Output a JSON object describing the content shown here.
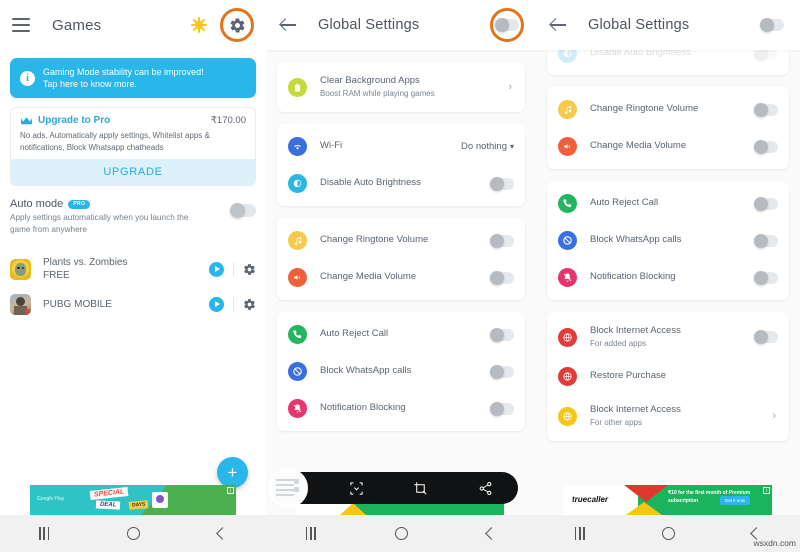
{
  "panel1": {
    "header": {
      "title": "Games",
      "menu_icon": "hamburger-icon",
      "sun_icon": "sun-icon",
      "gear_icon": "gear-icon"
    },
    "banner": {
      "icon": "info-icon",
      "line1": "Gaming Mode stability can be improved!",
      "line2": "Tap here to know more."
    },
    "upgrade": {
      "icon": "crown-icon",
      "title": "Upgrade to Pro",
      "price": "₹170.00",
      "description": "No ads, Automatically apply settings, Whitelist apps & notifications, Block Whatsapp chatheads",
      "button": "UPGRADE"
    },
    "auto_mode": {
      "title": "Auto mode",
      "badge": "PRO",
      "subtitle": "Apply settings automatically when you launch the game from anywhere",
      "toggle_on": false
    },
    "games": [
      {
        "name": "Plants vs. Zombies",
        "sub": "FREE",
        "play_icon": "play-icon",
        "gear_icon": "gear-icon"
      },
      {
        "name": "PUBG MOBILE",
        "sub": "",
        "play_icon": "play-icon",
        "gear_icon": "gear-icon"
      }
    ],
    "fab": {
      "label": "+",
      "icon": "plus-icon"
    },
    "ad": {
      "brand": "Google Play",
      "text1": "SPECIAL",
      "text2": "DEAL",
      "text3": "DAYS",
      "badge": "i"
    }
  },
  "panel2": {
    "header": {
      "back_icon": "back-arrow-icon",
      "title": "Global Settings",
      "toggle_on": false,
      "highlighted": true
    },
    "cards": [
      {
        "rows": [
          {
            "icon": "trash-icon",
            "icon_color": "#c5d93b",
            "label": "Clear Background Apps",
            "sub": "Boost RAM while playing games",
            "control": "chevron",
            "chevron": "›"
          }
        ]
      },
      {
        "rows": [
          {
            "icon": "wifi-icon",
            "icon_color": "#3b6ede",
            "label": "Wi-Fi",
            "sub": "",
            "control": "dropdown",
            "value": "Do nothing"
          },
          {
            "icon": "brightness-icon",
            "icon_color": "#29b6e8",
            "label": "Disable Auto Brightness",
            "sub": "",
            "control": "toggle",
            "toggle_on": false
          }
        ]
      },
      {
        "rows": [
          {
            "icon": "music-note-icon",
            "icon_color": "#f7c948",
            "label": "Change Ringtone Volume",
            "sub": "",
            "control": "toggle",
            "toggle_on": false
          },
          {
            "icon": "speaker-icon",
            "icon_color": "#f0603c",
            "label": "Change Media Volume",
            "sub": "",
            "control": "toggle",
            "toggle_on": false
          }
        ]
      },
      {
        "rows": [
          {
            "icon": "phone-reject-icon",
            "icon_color": "#22b562",
            "label": "Auto Reject Call",
            "sub": "",
            "control": "toggle",
            "toggle_on": false
          },
          {
            "icon": "block-call-icon",
            "icon_color": "#3b6ede",
            "label": "Block WhatsApp calls",
            "sub": "",
            "control": "toggle",
            "toggle_on": false
          },
          {
            "icon": "bell-off-icon",
            "icon_color": "#e8356d",
            "label": "Notification Blocking",
            "sub": "",
            "control": "toggle",
            "toggle_on": false
          }
        ]
      }
    ],
    "screenshot_toolbar": {
      "thumbnail": "screenshot-thumbnail",
      "buttons": [
        "scroll-capture-icon",
        "crop-edit-icon",
        "share-icon"
      ]
    }
  },
  "panel3": {
    "header": {
      "back_icon": "back-arrow-icon",
      "title": "Global Settings",
      "toggle_on": false
    },
    "scrolled_row": {
      "icon": "brightness-icon",
      "icon_color": "#29b6e8",
      "label": "Disable Auto Brightness",
      "control": "toggle",
      "toggle_on": false
    },
    "cards": [
      {
        "rows": [
          {
            "icon": "music-note-icon",
            "icon_color": "#f7c948",
            "label": "Change Ringtone Volume",
            "sub": "",
            "control": "toggle",
            "toggle_on": false
          },
          {
            "icon": "speaker-icon",
            "icon_color": "#f0603c",
            "label": "Change Media Volume",
            "sub": "",
            "control": "toggle",
            "toggle_on": false
          }
        ]
      },
      {
        "rows": [
          {
            "icon": "phone-reject-icon",
            "icon_color": "#22b562",
            "label": "Auto Reject Call",
            "sub": "",
            "control": "toggle",
            "toggle_on": false
          },
          {
            "icon": "block-call-icon",
            "icon_color": "#3b6ede",
            "label": "Block WhatsApp calls",
            "sub": "",
            "control": "toggle",
            "toggle_on": false
          },
          {
            "icon": "bell-off-icon",
            "icon_color": "#e8356d",
            "label": "Notification Blocking",
            "sub": "",
            "control": "toggle",
            "toggle_on": false
          }
        ]
      },
      {
        "rows": [
          {
            "icon": "globe-block-icon",
            "icon_color": "#e03c3c",
            "label": "Block Internet Access",
            "sub": "For added apps",
            "control": "toggle",
            "toggle_on": false
          },
          {
            "icon": "globe-block-icon",
            "icon_color": "#e03c3c",
            "label": "Restore Purchase",
            "sub": "",
            "control": "none"
          },
          {
            "icon": "globe-block-icon",
            "icon_color": "#f5c518",
            "label": "Block Internet Access",
            "sub": "For other apps",
            "control": "chevron",
            "chevron": "›"
          }
        ]
      }
    ],
    "ad": {
      "brand": "truecaller",
      "copy": "₹10 for the first month of Premium subscription",
      "cta": "Get it now",
      "badge": "i"
    },
    "watermark": "wsxdn.com"
  },
  "navbar": {
    "recent_icon": "recent-apps-icon",
    "home_icon": "home-icon",
    "back_icon": "back-icon"
  },
  "colors": {
    "accent_blue": "#29b6e8",
    "highlight_orange": "#e2741c",
    "toggle_off_track": "#e6e9ec",
    "toggle_off_knob": "#b6bbc1",
    "page_bg": "#fafafa"
  }
}
